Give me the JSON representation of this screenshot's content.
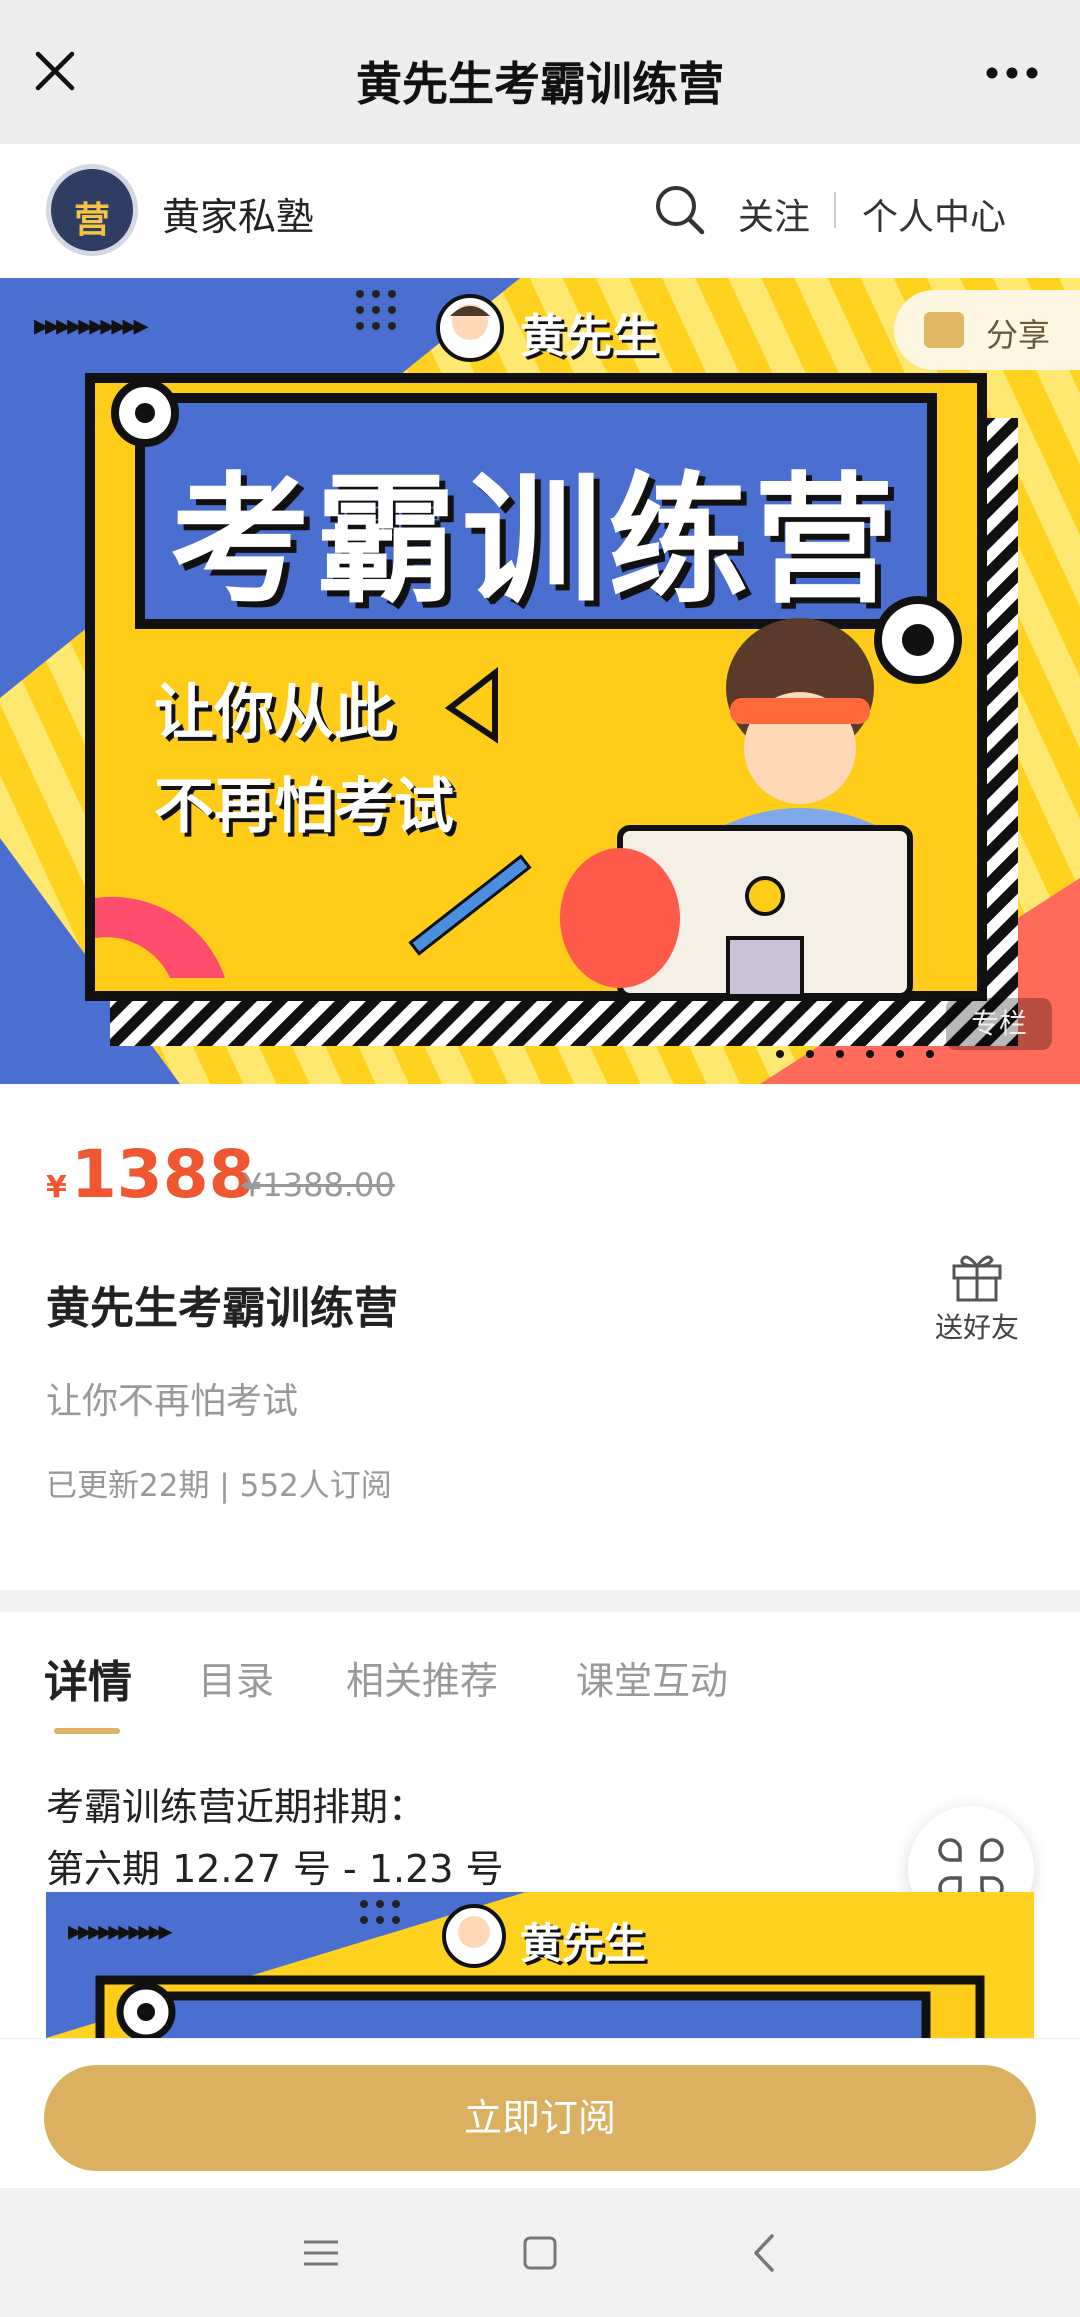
{
  "titlebar": {
    "title": "黄先生考霸训练营"
  },
  "shop": {
    "logo_text": "营",
    "name": "黄家私塾",
    "follow_label": "关注",
    "center_label": "个人中心"
  },
  "banner": {
    "share_label": "分享",
    "top_arrows": "▸▸▸▸▸▸▸▸▸▸",
    "presenter": "黄先生",
    "headline": "考霸训练营",
    "slogan_line1": "让你从此",
    "slogan_line2": "不再怕考试",
    "tag": "专栏"
  },
  "product": {
    "currency": "¥",
    "price": "1388",
    "original_price": "¥1388.00",
    "title": "黄先生考霸训练营",
    "gift_label": "送好友",
    "subtitle": "让你不再怕考试",
    "meta": "已更新22期 | 552人订阅"
  },
  "tabs": [
    {
      "label": "详情",
      "active": true
    },
    {
      "label": "目录",
      "active": false
    },
    {
      "label": "相关推荐",
      "active": false
    },
    {
      "label": "课堂互动",
      "active": false
    }
  ],
  "detail": {
    "line1": "考霸训练营近期排期：",
    "line2": "第六期  12.27 号 -  1.23 号"
  },
  "subscribe": {
    "label": "立即订阅"
  },
  "colors": {
    "accent": "#dbb061",
    "price": "#f0562f",
    "banner_yellow": "#ffcc1a",
    "banner_blue": "#4a6fd0"
  }
}
